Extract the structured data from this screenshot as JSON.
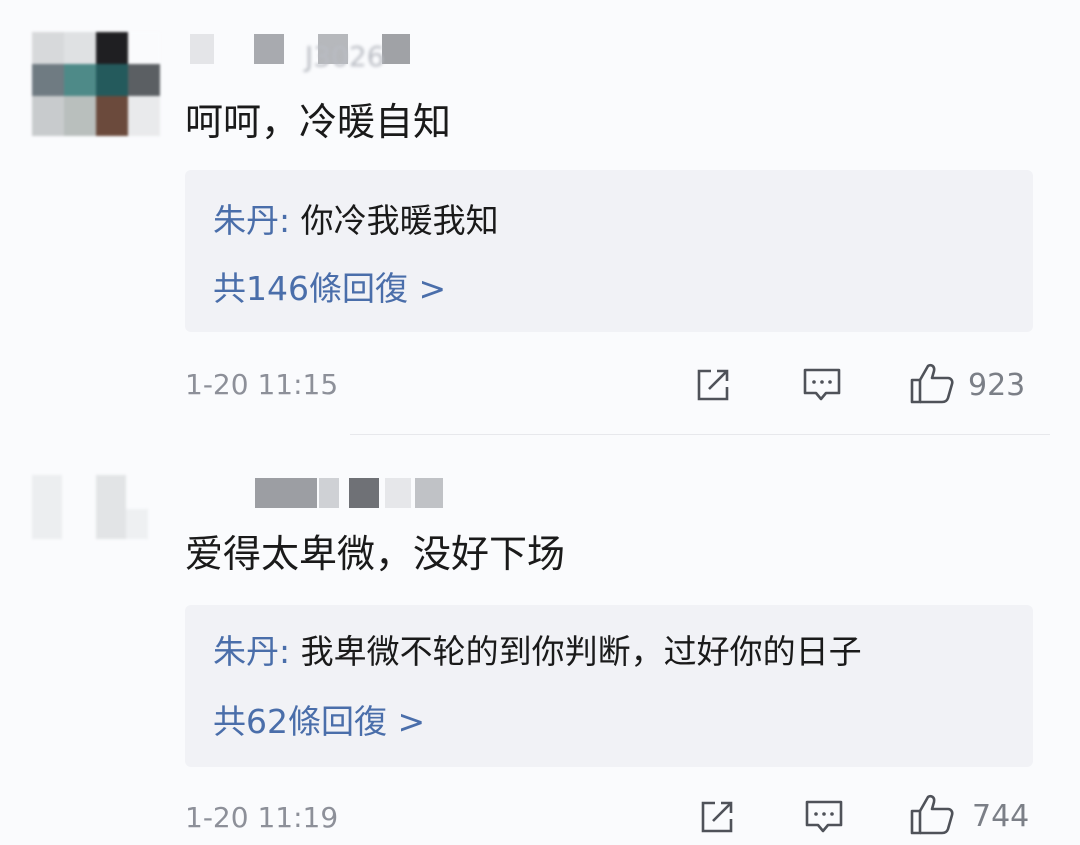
{
  "comments": [
    {
      "username_tail": "J3026",
      "text": "呵呵，冷暖自知",
      "reply": {
        "author": "朱丹",
        "separator": ": ",
        "text": "你冷我暖我知",
        "count_text": "共146條回復 >"
      },
      "time": "1-20 11:15",
      "likes": "923"
    },
    {
      "username_tail": "",
      "text": "爱得太卑微，没好下场",
      "reply": {
        "author": "朱丹",
        "separator": ": ",
        "text": "我卑微不轮的到你判断，过好你的日子",
        "count_text": "共62條回復 >"
      },
      "time": "1-20 11:19",
      "likes": "744"
    }
  ],
  "icons": {
    "share": "share-icon",
    "comment": "comment-icon",
    "like": "thumbs-up-icon"
  },
  "colors": {
    "reply_author": "#4a6eaa",
    "reply_background": "#f1f2f6",
    "meta_text": "#8d9099"
  }
}
